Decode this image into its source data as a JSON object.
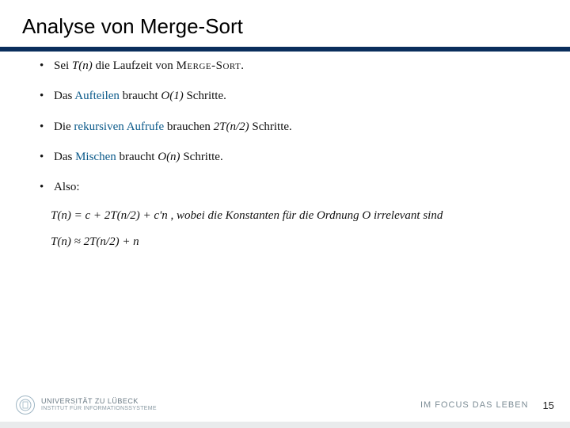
{
  "title": "Analyse von Merge-Sort",
  "bullets": [
    {
      "pre": "Sei ",
      "mid_it": "T(n)",
      "post": " die Laufzeit von ",
      "sc": "Merge-Sort",
      "tail": "."
    },
    {
      "pre": "Das ",
      "accent": "Aufteilen",
      "post": " braucht ",
      "mid_it": "O(1)",
      "tail": " Schritte."
    },
    {
      "pre": "Die ",
      "accent": "rekursiven Aufrufe",
      "post": " brauchen ",
      "mid_it": "2T(n/2)",
      "tail": " Schritte."
    },
    {
      "pre": "Das ",
      "accent": "Mischen",
      "post": " braucht ",
      "mid_it": "O(n)",
      "tail": " Schritte."
    },
    {
      "pre": "Also:",
      "accent": "",
      "post": "",
      "mid_it": "",
      "tail": ""
    }
  ],
  "formulas": {
    "line1": "T(n) = c + 2T(n/2) + c'n , wobei die Konstanten für die Ordnung O irrelevant sind",
    "line2": "T(n) ≈ 2T(n/2) + n"
  },
  "footer": {
    "university": "UNIVERSITÄT ZU LÜBECK",
    "institute": "INSTITUT FÜR INFORMATIONSSYSTEME",
    "motto": "IM FOCUS DAS LEBEN",
    "page": "15"
  }
}
